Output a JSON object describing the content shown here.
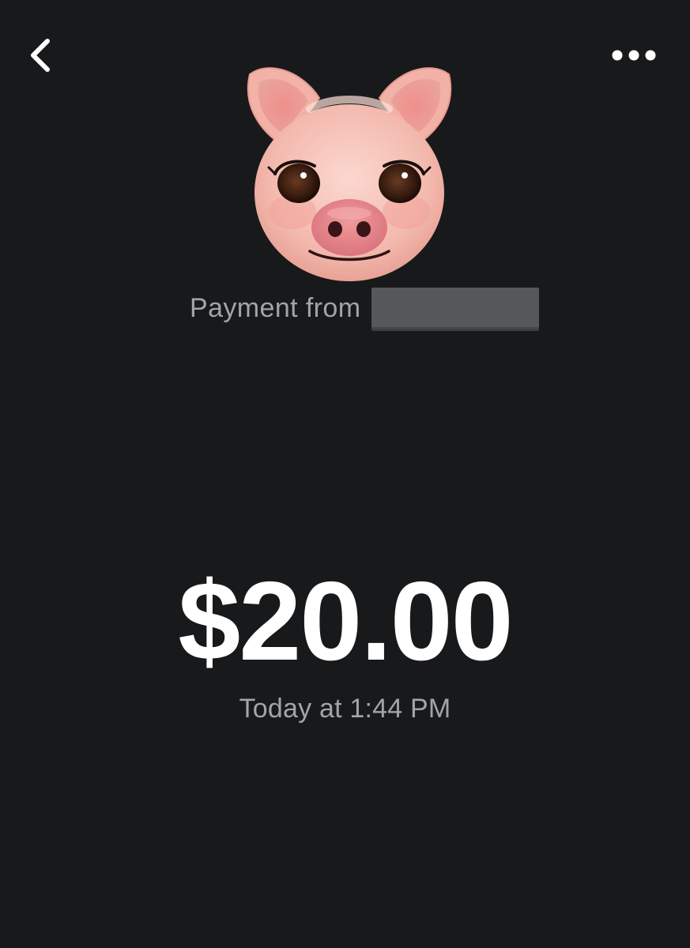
{
  "header": {
    "back_icon": "chevron-left-icon",
    "more_icon": "more-horizontal-icon"
  },
  "avatar": {
    "icon": "pig-face-icon"
  },
  "transaction": {
    "sender_label": "Payment from",
    "sender_name": "",
    "amount": "$20.00",
    "timestamp": "Today at 1:44 PM"
  },
  "colors": {
    "background": "#18191b",
    "primary_text": "#ffffff",
    "secondary_text": "#a3a4a7",
    "redaction": "#56575a",
    "pig_skin": "#f3b9ae",
    "pig_snout": "#e07d82"
  }
}
